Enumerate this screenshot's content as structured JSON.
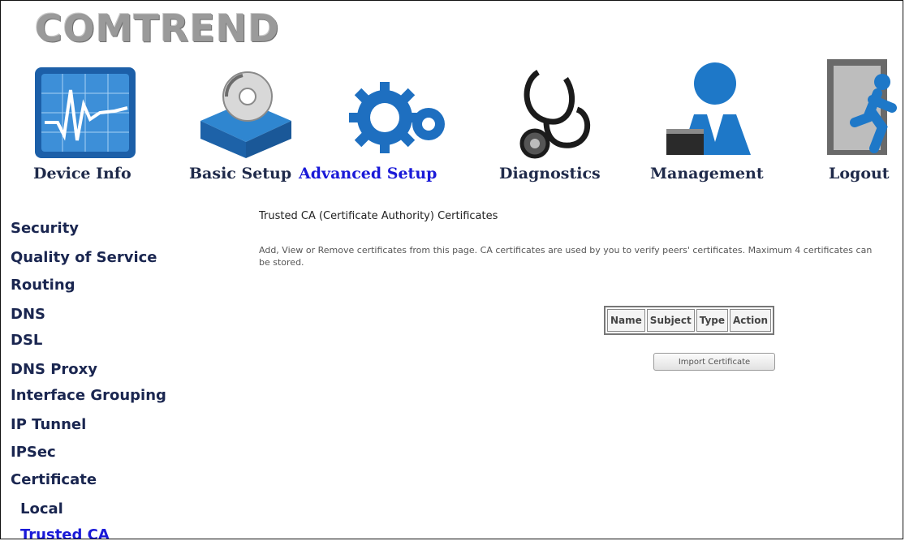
{
  "brand": {
    "name": "COMTREND"
  },
  "nav": [
    {
      "label": "Device Info",
      "icon": "monitor-chart-icon"
    },
    {
      "label": "Basic Setup",
      "icon": "cd-box-icon"
    },
    {
      "label": "Advanced Setup",
      "icon": "gears-icon",
      "active": true
    },
    {
      "label": "Diagnostics",
      "icon": "stethoscope-icon"
    },
    {
      "label": "Management",
      "icon": "user-icon"
    },
    {
      "label": "Logout",
      "icon": "exit-door-icon"
    }
  ],
  "sidebar": {
    "items": [
      {
        "label": "Security"
      },
      {
        "label": "Quality of Service"
      },
      {
        "label": "Routing"
      },
      {
        "label": "DNS"
      },
      {
        "label": "DSL"
      },
      {
        "label": "DNS Proxy"
      },
      {
        "label": "Interface Grouping"
      },
      {
        "label": "IP Tunnel"
      },
      {
        "label": "IPSec"
      },
      {
        "label": "Certificate"
      },
      {
        "label": "Local"
      },
      {
        "label": "Trusted CA",
        "active": true
      }
    ]
  },
  "main": {
    "title": "Trusted CA (Certificate Authority) Certificates",
    "description": "Add, View or Remove certificates from this page. CA certificates are used by you to verify peers' certificates. Maximum 4 certificates can be stored.",
    "table": {
      "headers": [
        "Name",
        "Subject",
        "Type",
        "Action"
      ]
    },
    "import_button": "Import Certificate"
  },
  "colors": {
    "active_link": "#1a1ad8",
    "nav_text": "#1f2a4a",
    "icon_blue": "#1e78c8"
  }
}
